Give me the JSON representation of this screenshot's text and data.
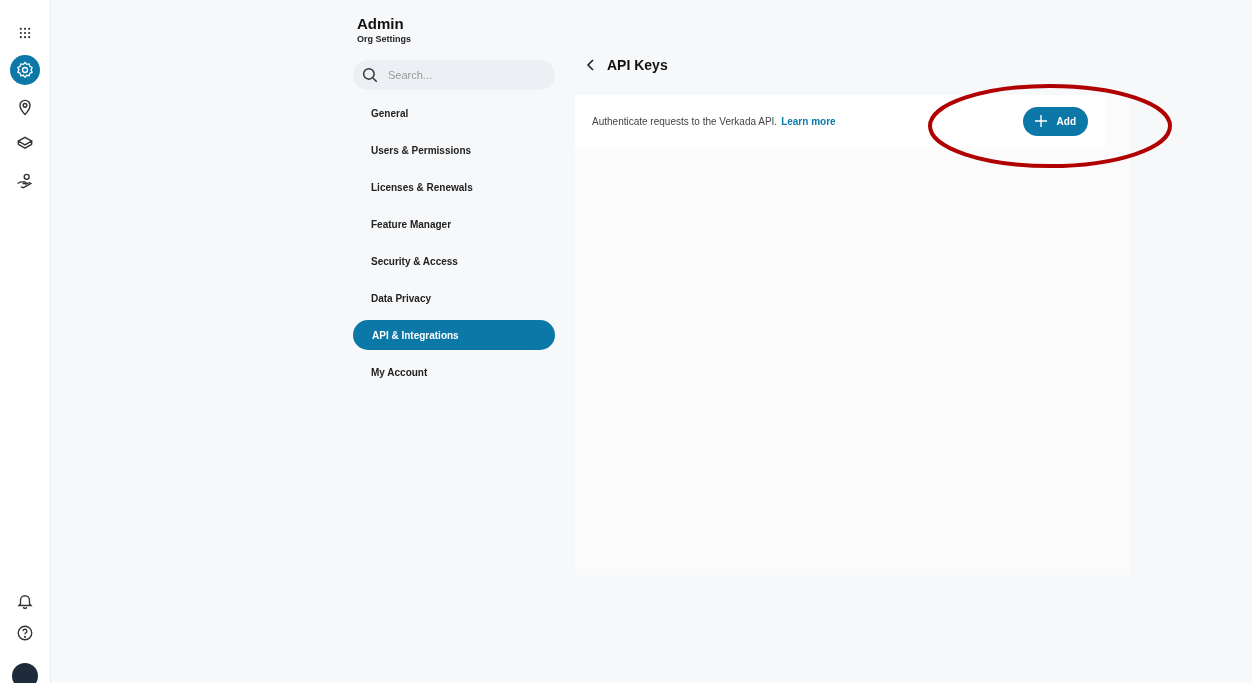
{
  "rail": {
    "items": [
      {
        "kind": "apps",
        "selected": false
      },
      {
        "kind": "settings",
        "selected": true
      },
      {
        "kind": "pin",
        "selected": false
      },
      {
        "kind": "layers",
        "selected": false
      },
      {
        "kind": "hand",
        "selected": false
      }
    ]
  },
  "header": {
    "title": "Admin",
    "subtitle": "Org Settings"
  },
  "search": {
    "placeholder": "Search..."
  },
  "nav": [
    {
      "label": "General",
      "selected": false
    },
    {
      "label": "Users & Permissions",
      "selected": false
    },
    {
      "label": "Licenses & Renewals",
      "selected": false
    },
    {
      "label": "Feature Manager",
      "selected": false
    },
    {
      "label": "Security & Access",
      "selected": false
    },
    {
      "label": "Data Privacy",
      "selected": false
    },
    {
      "label": "API & Integrations",
      "selected": true
    },
    {
      "label": "My Account",
      "selected": false
    }
  ],
  "page": {
    "title": "API Keys",
    "description": "Authenticate requests to the Verkada API.",
    "link": "Learn more",
    "button": "Add"
  }
}
